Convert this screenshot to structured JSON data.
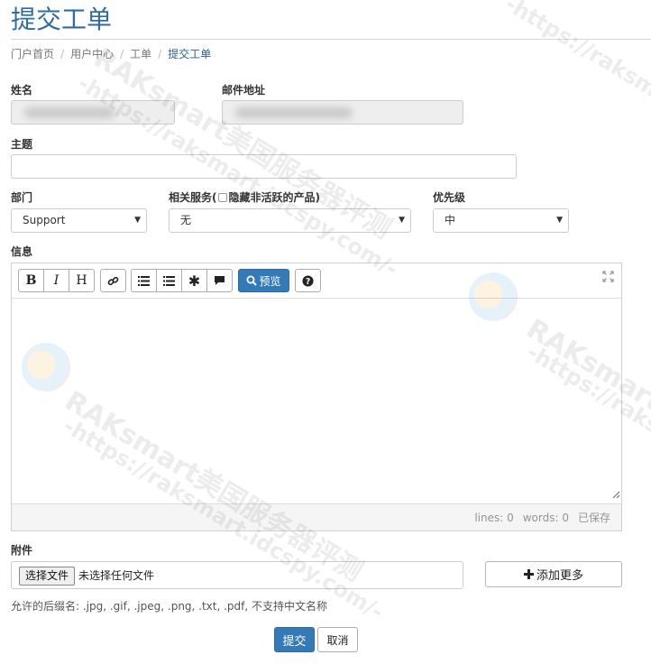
{
  "page": {
    "title": "提交工单"
  },
  "breadcrumb": {
    "items": [
      "门户首页",
      "用户中心",
      "工单",
      "提交工单"
    ]
  },
  "form": {
    "name_label": "姓名",
    "email_label": "邮件地址",
    "subject_label": "主题",
    "subject_value": "",
    "department_label": "部门",
    "department_value": "Support",
    "service_label_prefix": "相关服务(",
    "service_hide_inactive_label": "隐藏非活跃的产品)",
    "service_value": "无",
    "priority_label": "优先级",
    "priority_value": "中",
    "message_label": "信息"
  },
  "editor": {
    "toolbar": {
      "bold": "B",
      "italic": "I",
      "heading": "H",
      "preview_label": "预览"
    },
    "status": {
      "lines": "lines: 0",
      "words": "words: 0",
      "saved": "已保存"
    }
  },
  "attachments": {
    "label": "附件",
    "choose_button": "选择文件",
    "no_file_text": "未选择任何文件",
    "add_more_label": "添加更多",
    "hint": "允许的后缀名: .jpg, .gif, .jpeg, .png, .txt, .pdf, 不支持中文名称"
  },
  "actions": {
    "submit": "提交",
    "cancel": "取消"
  },
  "watermark": {
    "line1": "RAKsmart美国服务器评测",
    "line2": "-https://raksmart.idcspy.com/-"
  },
  "colors": {
    "primary": "#337ab7",
    "title": "#2e6ca4",
    "readonly_bg": "#eeeeee",
    "border": "#cccccc"
  }
}
